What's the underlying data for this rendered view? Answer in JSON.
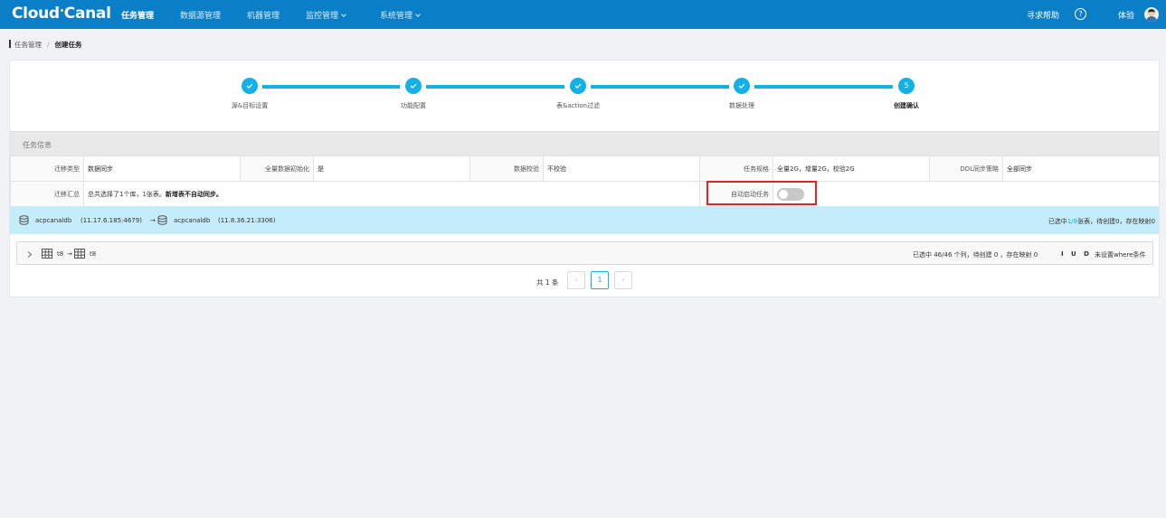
{
  "topnav": {
    "logo_left": "Cloud",
    "logo_right": "Canal",
    "items": [
      {
        "label": "任务管理",
        "dropdown": false
      },
      {
        "label": "数据源管理",
        "dropdown": false
      },
      {
        "label": "机器管理",
        "dropdown": false
      },
      {
        "label": "监控管理",
        "dropdown": true
      },
      {
        "label": "系统管理",
        "dropdown": true
      }
    ],
    "help": "寻求帮助",
    "help_icon": "?",
    "user": "体验"
  },
  "breadcrumb": {
    "parent": "任务管理",
    "separator": "/",
    "current": "创建任务"
  },
  "steps": [
    {
      "label": "源&目标设置",
      "status": "done"
    },
    {
      "label": "功能配置",
      "status": "done"
    },
    {
      "label": "表&action过滤",
      "status": "done"
    },
    {
      "label": "数据处理",
      "status": "done"
    },
    {
      "label": "创建确认",
      "status": "current",
      "number": "5"
    }
  ],
  "section_title": "任务信息",
  "info": {
    "row1": [
      {
        "label": "迁移类型",
        "value": "数据同步"
      },
      {
        "label": "全量数据初始化",
        "value": "是"
      },
      {
        "label": "数据校验",
        "value": "不校验"
      },
      {
        "label": "任务规格",
        "value": "全量2G，增量2G，校验2G"
      },
      {
        "label": "DDL同步策略",
        "value": "全部同步"
      }
    ],
    "summary_label": "迁移汇总",
    "summary_text": "总共选择了1个库，1张表。",
    "summary_bold": "新增表不自动同步。",
    "auto_start_label": "自动启动任务",
    "auto_start_enabled": false
  },
  "db_mapping": {
    "source_db": "acpcanaldb",
    "source_addr": "(11.17.6.185:4679)",
    "arrow": "→",
    "target_db": "acpcanaldb",
    "target_addr": "(11.8.36.21:3306)",
    "summary_prefix": "已选中",
    "summary_count": "1/8",
    "summary_suffix": "张表，待创建0，存在映射0"
  },
  "table_mapping": {
    "source_table": "t8",
    "arrow": "→",
    "target_table": "t8",
    "column_summary": "已选中 46/46 个列，待创建 0 ，存在映射 0",
    "iud": "I U D",
    "where_hint": "未设置where条件"
  },
  "pagination": {
    "total": "共 1 条",
    "prev": "‹",
    "page": "1",
    "next": "›"
  },
  "colors": {
    "nav_bg": "#0a7fc7",
    "accent": "#14b1e7",
    "db_bar_bg": "#c5ecf9",
    "highlight_border": "#e0242b",
    "iud_green": "#1ab15a"
  }
}
